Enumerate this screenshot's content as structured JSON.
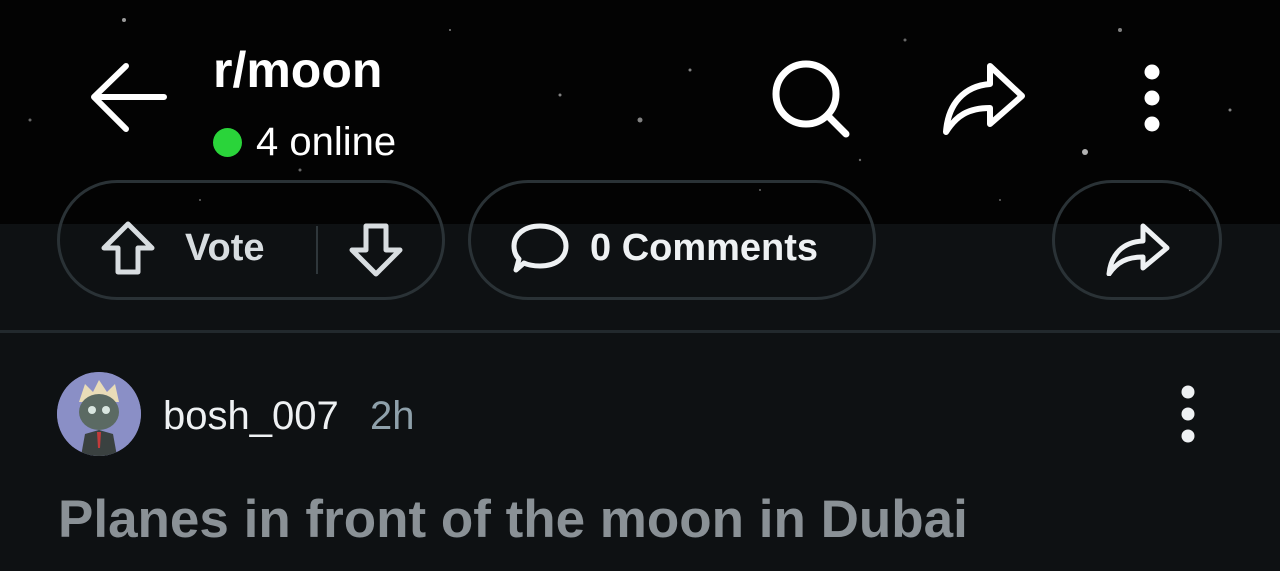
{
  "header": {
    "subreddit": "r/moon",
    "online_count": "4 online",
    "icons": [
      "back-arrow-icon",
      "search-icon",
      "share-icon",
      "more-vertical-icon"
    ],
    "accent_online": "#2ad43a"
  },
  "actions": {
    "vote_label": "Vote",
    "comments_label": "0 Comments",
    "icons": [
      "upvote-icon",
      "downvote-icon",
      "comment-icon",
      "share-icon"
    ]
  },
  "post": {
    "author": "bosh_007",
    "age": "2h",
    "title": "Planes in front of the moon in Dubai",
    "avatar_bg": "#8a8fc6"
  }
}
